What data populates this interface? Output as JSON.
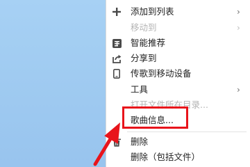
{
  "menu": {
    "items": [
      {
        "label": "添加到列表",
        "icon": "plus-icon",
        "has_submenu": true,
        "disabled": false
      },
      {
        "label": "移动到",
        "icon": "",
        "has_submenu": true,
        "disabled": true
      },
      {
        "label": "智能推荐",
        "icon": "recommend-icon",
        "has_submenu": false,
        "disabled": false
      },
      {
        "label": "分享到",
        "icon": "share-icon",
        "has_submenu": false,
        "disabled": false
      },
      {
        "label": "传歌到移动设备",
        "icon": "phone-icon",
        "has_submenu": false,
        "disabled": false
      },
      {
        "label": "工具",
        "icon": "",
        "has_submenu": true,
        "disabled": false
      },
      {
        "label": "打开文件所在目录...",
        "icon": "",
        "has_submenu": false,
        "disabled": true
      },
      {
        "label": "歌曲信息...",
        "icon": "",
        "has_submenu": false,
        "disabled": false,
        "highlighted": true
      },
      {
        "label": "删除",
        "icon": "trash-icon",
        "has_submenu": false,
        "disabled": false
      },
      {
        "label": "删除（包括文件）",
        "icon": "",
        "has_submenu": false,
        "disabled": false
      }
    ],
    "submenu_arrow": "›"
  },
  "colors": {
    "desktop": "#a0cbf1",
    "annotation": "#e8141b",
    "icon": "#4a4a4a",
    "disabled_text": "#b4b4b4"
  }
}
